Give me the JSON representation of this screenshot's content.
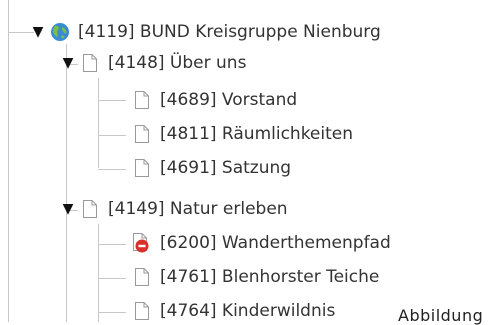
{
  "tree": {
    "root": {
      "label": "[4119] BUND Kreisgruppe Nienburg",
      "icon": "globe-icon"
    },
    "groups": [
      {
        "label": "[4148] Über uns",
        "children": [
          {
            "label": "[4689] Vorstand",
            "icon": "page-icon"
          },
          {
            "label": "[4811] Räumlichkeiten",
            "icon": "page-icon"
          },
          {
            "label": "[4691] Satzung",
            "icon": "page-icon"
          }
        ]
      },
      {
        "label": "[4149] Natur erleben",
        "children": [
          {
            "label": "[6200] Wanderthemenpfad",
            "icon": "page-restricted-icon"
          },
          {
            "label": "[4761] Blenhorster Teiche",
            "icon": "page-icon"
          },
          {
            "label": "[4764] Kinderwildnis",
            "icon": "page-icon"
          }
        ]
      }
    ]
  },
  "overlay": {
    "text": "Abbildung"
  },
  "colors": {
    "tree_line": "#c7c7c7",
    "globe_blue": "#3a8bd6",
    "globe_green": "#7cc043",
    "restricted_red": "#d9302c"
  }
}
